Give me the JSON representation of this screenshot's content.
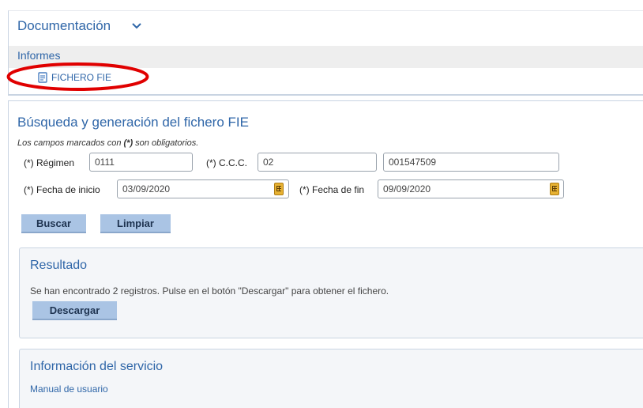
{
  "documentation": {
    "title": "Documentación",
    "section": "Informes",
    "link": {
      "label": "FICHERO FIE",
      "icon": "document-icon"
    },
    "expand_icon": "chevron-down-icon"
  },
  "search": {
    "title": "Búsqueda y generación del fichero FIE",
    "mandatory_note_prefix": "Los campos marcados con ",
    "mandatory_note_marker": "(*)",
    "mandatory_note_suffix": " son obligatorios.",
    "regimen": {
      "label": "(*) Régimen",
      "value": "0111"
    },
    "ccc": {
      "label": "(*) C.C.C.",
      "value_prefix": "02",
      "value_number": "001547509"
    },
    "fecha_inicio": {
      "label": "(*) Fecha de inicio",
      "value": "03/09/2020",
      "icon": "calendar-icon"
    },
    "fecha_fin": {
      "label": "(*) Fecha de fin",
      "value": "09/09/2020",
      "icon": "calendar-icon"
    },
    "buttons": {
      "search": "Buscar",
      "clear": "Limpiar"
    }
  },
  "result": {
    "title": "Resultado",
    "message": "Se han encontrado 2 registros. Pulse en el botón \"Descargar\" para obtener el fichero.",
    "download_button": "Descargar"
  },
  "service_info": {
    "title": "Información del servicio",
    "manual_link": "Manual de usuario"
  },
  "colors": {
    "accent": "#2f66a8",
    "button_bg": "#aac4e4",
    "highlight_annotation": "#e00000",
    "calendar_icon": "#e7b233"
  }
}
